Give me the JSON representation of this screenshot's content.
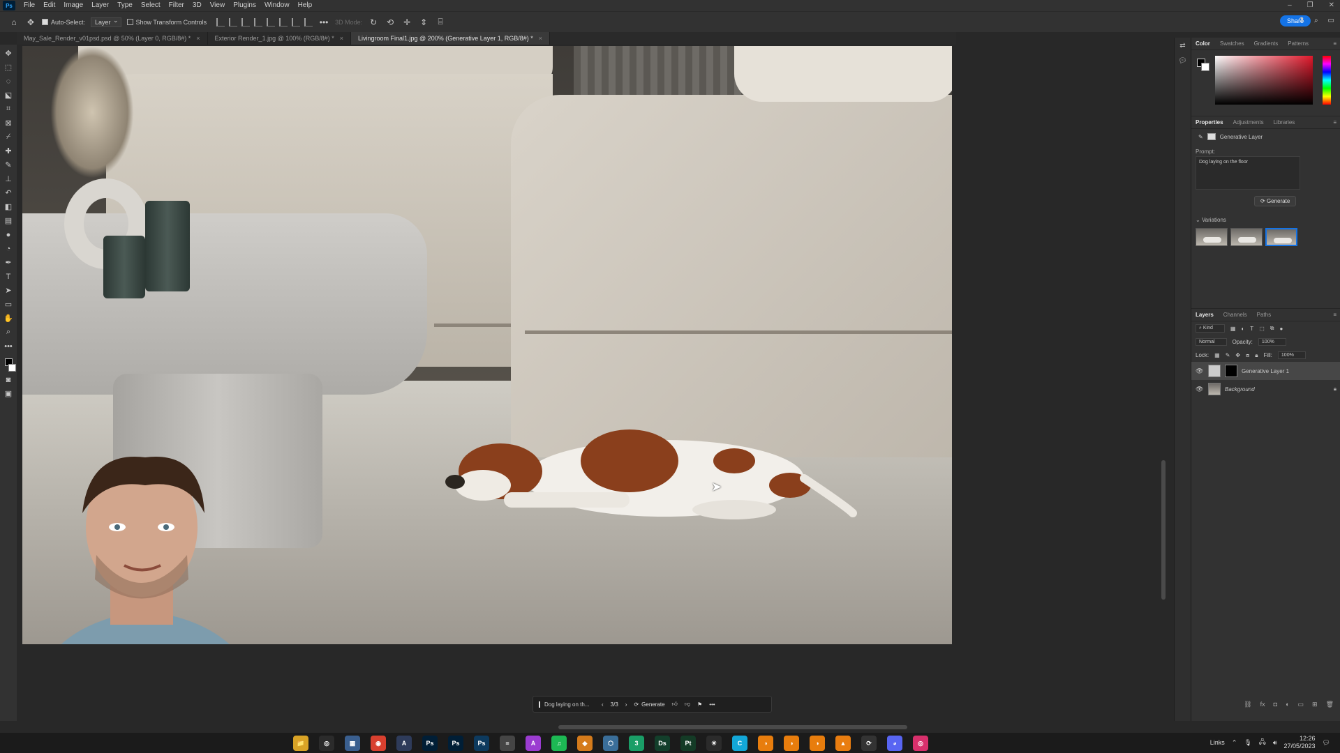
{
  "menubar": {
    "logo": "Ps",
    "items": [
      "File",
      "Edit",
      "Image",
      "Layer",
      "Type",
      "Select",
      "Filter",
      "3D",
      "View",
      "Plugins",
      "Window",
      "Help"
    ],
    "window_controls": [
      "–",
      "❐",
      "✕"
    ]
  },
  "optionsbar": {
    "auto_select_label": "Auto-Select:",
    "auto_select_value": "Layer",
    "transform_label": "Show Transform Controls",
    "mode_3d_label": "3D Mode:",
    "share_label": "Share"
  },
  "tabs": [
    {
      "label": "May_Sale_Render_v01psd.psd @ 50% (Layer 0, RGB/8#) *",
      "active": false
    },
    {
      "label": "Exterior Render_1.jpg @ 100% (RGB/8#) *",
      "active": false
    },
    {
      "label": "Livingroom Final1.jpg @ 200% (Generative Layer 1, RGB/8#) *",
      "active": true
    }
  ],
  "generative_bar": {
    "prompt": "Dog laying on th...",
    "counter": "3/3",
    "generate_label": "Generate"
  },
  "panels": {
    "color_tabs": [
      "Color",
      "Swatches",
      "Gradients",
      "Patterns"
    ],
    "properties_tabs": [
      "Properties",
      "Adjustments",
      "Libraries"
    ],
    "layer_type": "Generative Layer",
    "prompt_label": "Prompt:",
    "prompt_text": "Dog laying on the floor",
    "generate_label": "Generate",
    "variations_label": "Variations",
    "variations_selected": 3,
    "layers_tabs": [
      "Layers",
      "Channels",
      "Paths"
    ],
    "kind_label": "Kind",
    "blend_mode": "Normal",
    "opacity_label": "Opacity:",
    "opacity_value": "100%",
    "lock_label": "Lock:",
    "fill_label": "Fill:",
    "fill_value": "100%",
    "layers": [
      {
        "name": "Generative Layer 1",
        "selected": true
      },
      {
        "name": "Background",
        "selected": false,
        "locked": true
      }
    ]
  },
  "taskbar": {
    "apps": [
      {
        "name": "file-explorer-icon",
        "label": "📁",
        "color": "#d9a326"
      },
      {
        "name": "app-icon-2",
        "label": "◎",
        "color": "#2b2b2b"
      },
      {
        "name": "calculator-icon",
        "label": "▦",
        "color": "#3a5f8f"
      },
      {
        "name": "chrome-icon",
        "label": "◉",
        "color": "#d8402f"
      },
      {
        "name": "app-icon-5",
        "label": "A",
        "color": "#2e3b5a"
      },
      {
        "name": "photoshop-icon-1",
        "label": "Ps",
        "color": "#001e36"
      },
      {
        "name": "photoshop-icon-2",
        "label": "Ps",
        "color": "#001e36"
      },
      {
        "name": "photoshop-icon-active",
        "label": "Ps",
        "color": "#0d3a5e"
      },
      {
        "name": "notes-icon",
        "label": "≡",
        "color": "#454545"
      },
      {
        "name": "affinity-icon",
        "label": "A",
        "color": "#9b3cd1"
      },
      {
        "name": "spotify-icon",
        "label": "♫",
        "color": "#1db954"
      },
      {
        "name": "box-icon",
        "label": "◆",
        "color": "#d57b1b"
      },
      {
        "name": "cube-icon",
        "label": "⬡",
        "color": "#3a6e99"
      },
      {
        "name": "app-icon-3",
        "label": "3",
        "color": "#1a9e67"
      },
      {
        "name": "dimension-icon",
        "label": "Ds",
        "color": "#133f2b"
      },
      {
        "name": "painter-icon",
        "label": "Pt",
        "color": "#143b26"
      },
      {
        "name": "sun-icon",
        "label": "☀",
        "color": "#2b2b2b"
      },
      {
        "name": "c-icon",
        "label": "C",
        "color": "#13a7d8"
      },
      {
        "name": "blender-icon-1",
        "label": "◑",
        "color": "#e87d0d"
      },
      {
        "name": "blender-icon-2",
        "label": "◑",
        "color": "#e87d0d"
      },
      {
        "name": "blender-icon-3",
        "label": "◑",
        "color": "#e87d0d"
      },
      {
        "name": "vlc-icon",
        "label": "▲",
        "color": "#e97d10"
      },
      {
        "name": "sync-icon",
        "label": "⟳",
        "color": "#333"
      },
      {
        "name": "discord-icon",
        "label": "◕",
        "color": "#5865f2"
      },
      {
        "name": "instagram-icon",
        "label": "◎",
        "color": "#d8306c"
      }
    ],
    "links_label": "Links",
    "time": "12:26",
    "date": "27/05/2023"
  }
}
